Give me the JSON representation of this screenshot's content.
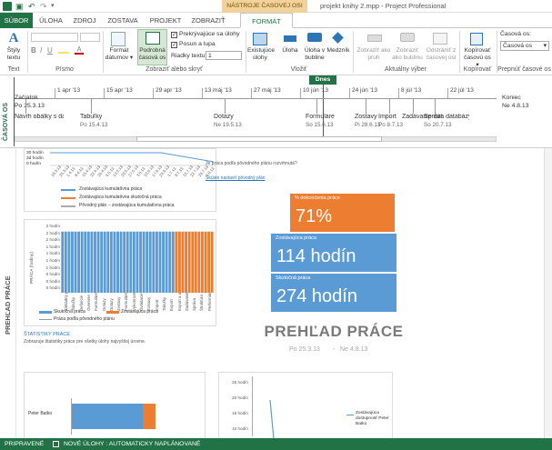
{
  "titlebar": {
    "context_tab": "NÁSTROJE ČASOVEJ OSI",
    "doc_title": "projekt knihy 2.mpp - Project Professional"
  },
  "tabs": [
    {
      "label": "SÚBOR"
    },
    {
      "label": "ÚLOHA"
    },
    {
      "label": "ZDROJ"
    },
    {
      "label": "ZOSTAVA"
    },
    {
      "label": "PROJEKT"
    },
    {
      "label": "ZOBRAZIŤ"
    },
    {
      "label": "FORMÁT"
    }
  ],
  "ribbon": {
    "text_group": {
      "btn": "Štýly textu",
      "label": "Text"
    },
    "font_group": {
      "label": "Písmo"
    },
    "show_group": {
      "format_dates": "Formát dátumov ▾",
      "detailed_timeline": "Podrobná časová os",
      "overlapping_tasks": "Prekrývajúce sa úlohy",
      "pan_zoom": "Posun a lupa",
      "text_lines_label": "Riadky textu:",
      "text_lines_value": "1",
      "label": "Zobraziť alebo skryť"
    },
    "insert_group": {
      "existing_tasks": "Existujúce úlohy",
      "task": "Úloha",
      "callout_task": "Úloha v bubline",
      "milestone": "Medzník",
      "label": "Vložiť"
    },
    "selection_group": {
      "bar": "Zobraziť ako pruh",
      "callout": "Zobraziť ako bublinu",
      "remove": "Odstrániť z časovej osi",
      "label": "Aktuálny výber"
    },
    "copy_group": {
      "copy": "Kopírovať časovú os ▾",
      "label": "Kopírovať"
    },
    "switch_group": {
      "field_label": "Časová os:",
      "field_value": "Časová os",
      "label": "Prepnúť časové os"
    }
  },
  "timeline": {
    "side_label": "ČASOVÁ OS",
    "today_badge": "Dnes",
    "start_label": "Začiatok",
    "start_date": "Po 25.3.13",
    "end_label": "Koniec",
    "end_date": "Ne 4.8.13",
    "scale": [
      "1 apr '13",
      "15 apr '13",
      "29 apr '13",
      "13 máj '13",
      "27 máj '13",
      "10 jún '13",
      "24 jún '13",
      "8 júl '13",
      "22 júl '13"
    ],
    "tasks": [
      {
        "name": "Návrh obálky s databázou",
        "date": ""
      },
      {
        "name": "Tabuľky",
        "date": "Po 15.4.13"
      },
      {
        "name": "Dotazy",
        "date": "Ne 19.5.13"
      },
      {
        "name": "Formuláre",
        "date": "So 15.6.13"
      },
      {
        "name": "Zostavy",
        "date": "Pi 28.6.13"
      },
      {
        "name": "Import",
        "date": "Po 8.7.13"
      },
      {
        "name": "Zadávanie dát",
        "date": ""
      },
      {
        "name": "Správa databázy",
        "date": "So 20.7.13"
      }
    ]
  },
  "report": {
    "side_label": "PREHĽAD PRÁCE",
    "top_chart_ticks": [
      "30 hodín",
      "3d hodín",
      "0 hodín"
    ],
    "top_chart_dates": [
      "18.3.13",
      "25.3.13",
      "1.4.13",
      "8.4.13",
      "15.4.13",
      "22.4.13",
      "29.4.13",
      "6.5.13",
      "13.5.13",
      "20.5.13",
      "27.5.13",
      "3.6.13",
      "10.6.13",
      "17.6.13",
      "24.6.13",
      "1.7.13",
      "8.7.13",
      "15.7.13",
      "22.7.13",
      "29.7.13",
      "5.8.13"
    ],
    "top_legend": [
      "Zostávajúca kumulatívna práca",
      "Zostávajúca kumulatívna skutočná práca",
      "Pôvodný plán – zostávajúca kumulatívna práca"
    ],
    "question": "Je práca podľa pôvodného plánu rozvrhnutá?",
    "link": "Skúste nastaviť pôvodný plán",
    "percent_label": "% dokončenia práce",
    "percent_value": "71%",
    "remaining_label": "Zostávajúca práca",
    "remaining_value": "114 hodín",
    "actual_label": "Skutočná práca",
    "actual_value": "274 hodín",
    "heading": "PREHĽAD PRÁCE",
    "start_date": "Po 25.3.13",
    "end_date": "Ne 4.8.13",
    "stats_y_title": "PRÁCA (hodiny)",
    "stats_ticks": [
      "2 hodín",
      "2 hodín",
      "2 hodín",
      "1 hodín",
      "1 hodín",
      "1 hodín",
      "1 hodín",
      "0 hodín",
      "0 hodín",
      "0 hodín"
    ],
    "stats_tasks": [
      "Základný projekt s...",
      "Tabuľky",
      "Definície",
      "Overenie",
      "Formuláre",
      "Dotazy",
      "Dotazy",
      "Zostavy",
      "Formuláre",
      "Výkonnosť",
      "Ovládacie prvky",
      "Zostavy",
      "Import",
      "Tabuľky",
      "Export",
      "Export a analýza",
      "Zadávanie dát",
      "Správa",
      "Štruktúra",
      "Preformátovanie"
    ],
    "stats_legend": [
      "Skutočná práca",
      "Zostávajúca práca",
      "Práca podľa pôvodného plánu"
    ],
    "stats_title": "ŠTATISTIKY PRÁCE",
    "stats_desc": "Zobrazuje štatistiky práce pre všetky úlohy najvyššej úrovne.",
    "resource_name": "Peter Batko",
    "resource_chart_ticks": [
      "25 hodín",
      "20 hodín",
      "15 hodín",
      "10 hodín",
      "5 hodín"
    ],
    "resource_legend": "Zostávajúca dostupnosť Peter Batko"
  },
  "chart_data": [
    {
      "type": "line",
      "title": "",
      "series": [
        {
          "name": "Zostávajúca kumulatívna práca",
          "values": []
        },
        {
          "name": "Zostávajúca kumulatívna skutočná práca",
          "values": []
        },
        {
          "name": "Pôvodný plán – zostávajúca kumulatívna práca",
          "values": []
        }
      ]
    },
    {
      "type": "bar",
      "ylabel": "PRÁCA (hodiny)",
      "series": [
        {
          "name": "Skutočná práca",
          "values": [
            2,
            2,
            2,
            2,
            2,
            2,
            2,
            2,
            2,
            2,
            2,
            2,
            2,
            2,
            2,
            2,
            2,
            2,
            2,
            2,
            2,
            2,
            2,
            2,
            2,
            2,
            2,
            2,
            2,
            2,
            2,
            2,
            2,
            2,
            2
          ]
        },
        {
          "name": "Zostávajúca práca",
          "values": [
            2,
            2,
            2,
            2,
            2,
            2,
            2,
            2,
            2,
            2,
            2,
            2
          ]
        }
      ]
    },
    {
      "type": "bar",
      "categories": [
        "Peter Batko"
      ],
      "series": [
        {
          "name": "Skutočná práca",
          "values": [
            274
          ]
        },
        {
          "name": "Zostávajúca práca",
          "values": [
            114
          ]
        }
      ]
    }
  ],
  "status": {
    "ready": "PRIPRAVENÉ",
    "new_tasks": "NOVÉ ÚLOHY : AUTOMATICKY NAPLÁNOVANÉ"
  },
  "colors": {
    "brand_green": "#217346",
    "orange": "#ED7D31",
    "blue": "#5B9BD5",
    "context_tab": "#E8A33C"
  }
}
